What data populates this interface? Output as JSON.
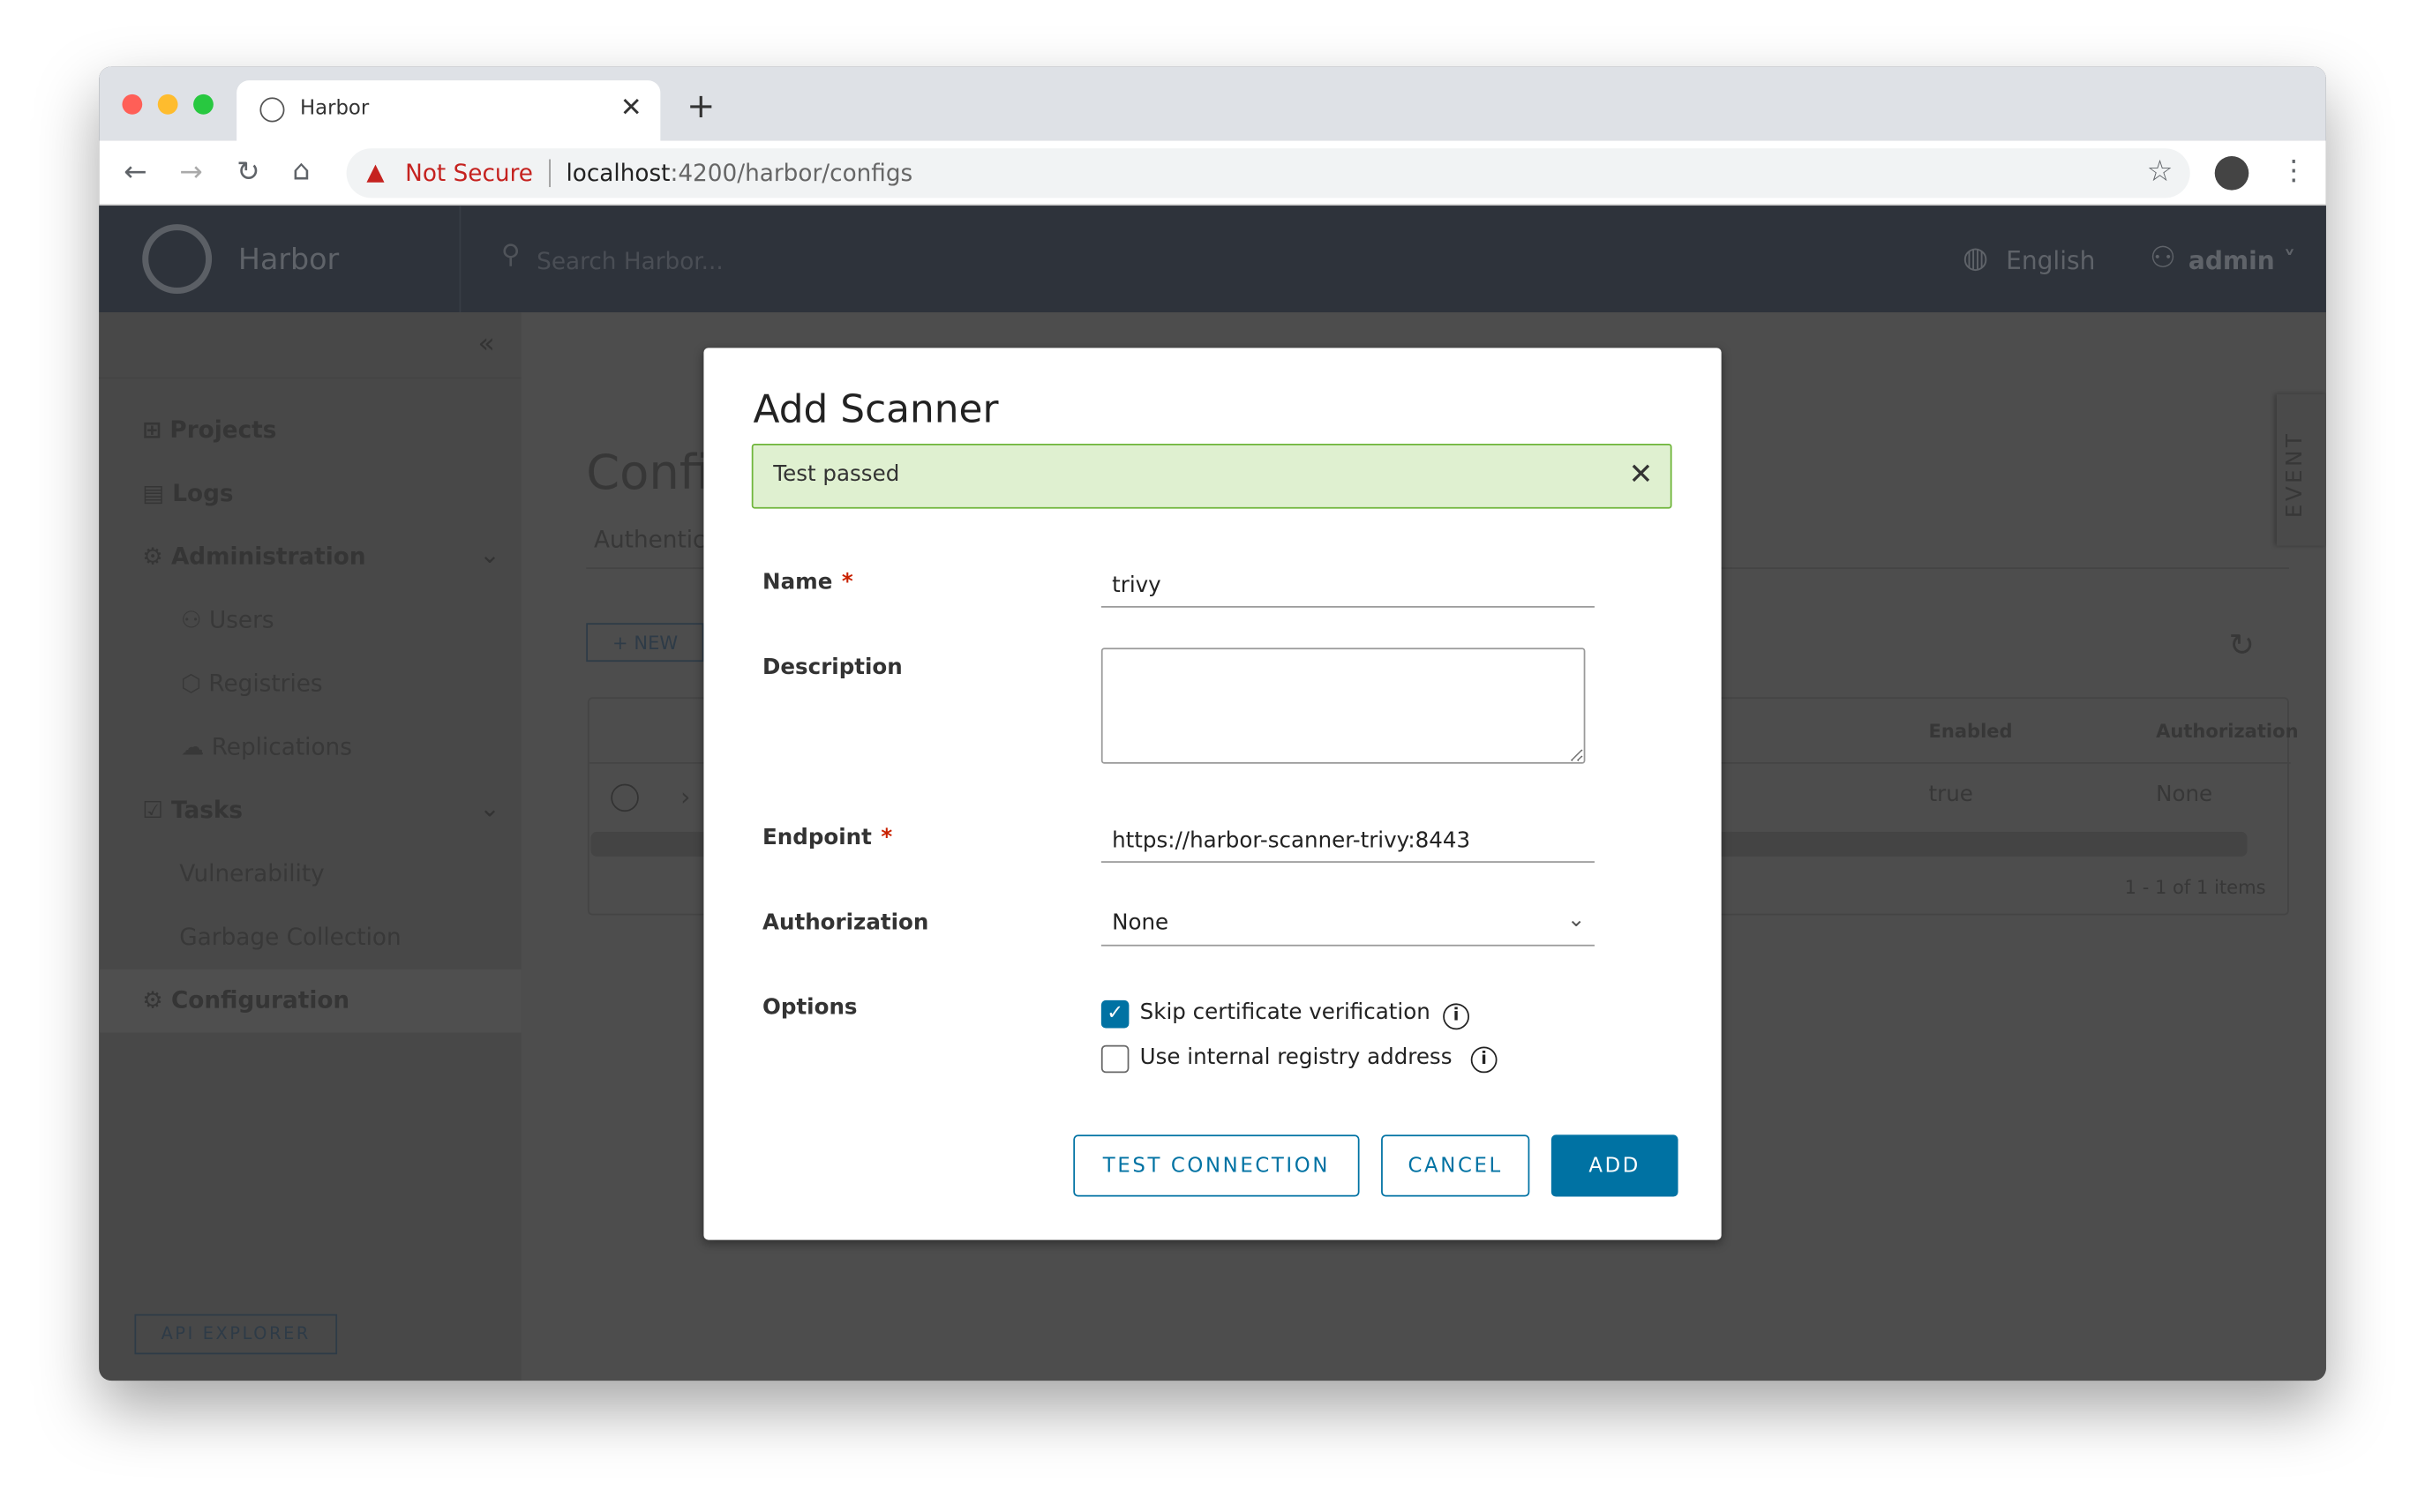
{
  "browser": {
    "tab_title": "Harbor",
    "not_secure": "Not Secure",
    "url_host": "localhost",
    "url_path": ":4200/harbor/configs"
  },
  "header": {
    "brand": "Harbor",
    "search_placeholder": "Search Harbor...",
    "language": "English",
    "user": "admin"
  },
  "sidebar": {
    "items": [
      {
        "label": "Projects"
      },
      {
        "label": "Logs"
      },
      {
        "label": "Administration"
      },
      {
        "label": "Users"
      },
      {
        "label": "Registries"
      },
      {
        "label": "Replications"
      },
      {
        "label": "Tasks"
      },
      {
        "label": "Vulnerability"
      },
      {
        "label": "Garbage Collection"
      },
      {
        "label": "Configuration"
      }
    ],
    "api_explorer": "API EXPLORER"
  },
  "page": {
    "title": "Confi",
    "tab": "Authentic",
    "new_button": "NEW",
    "columns": [
      "Enabled",
      "Authorization"
    ],
    "row": {
      "enabled": "true",
      "authorization": "None"
    },
    "pagination": "1 - 1 of 1 items",
    "event_tab": "EVENT"
  },
  "modal": {
    "title": "Add Scanner",
    "alert": "Test passed",
    "alert_color": "#dff0d0",
    "fields": {
      "name_label": "Name",
      "name_value": "trivy",
      "description_label": "Description",
      "description_value": "",
      "endpoint_label": "Endpoint",
      "endpoint_value": "https://harbor-scanner-trivy:8443",
      "authorization_label": "Authorization",
      "authorization_value": "None",
      "options_label": "Options"
    },
    "options": [
      {
        "label": "Skip certificate verification",
        "checked": true
      },
      {
        "label": "Use internal registry address",
        "checked": false
      }
    ],
    "buttons": {
      "test": "TEST CONNECTION",
      "cancel": "CANCEL",
      "add": "ADD"
    },
    "accent": "#0072a3"
  }
}
